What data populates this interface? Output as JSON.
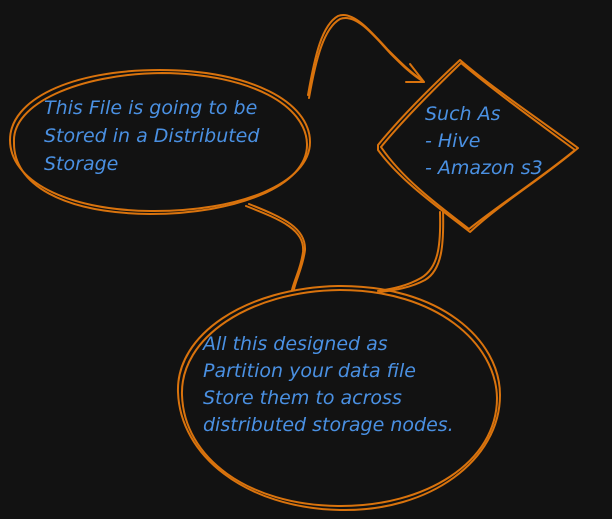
{
  "diagram": {
    "nodes": [
      {
        "id": "file-storage",
        "shape": "ellipse",
        "lines": [
          "This File is going to be",
          "Stored in a Distributed",
          "Storage"
        ]
      },
      {
        "id": "examples",
        "shape": "diamond",
        "lines": [
          "Such As",
          "- Hive",
          "- Amazon s3"
        ]
      },
      {
        "id": "partition",
        "shape": "ellipse",
        "lines": [
          "All this designed as",
          "Partition your data file",
          "Store them to across",
          "distributed storage nodes."
        ]
      }
    ],
    "edges": [
      {
        "from": "file-storage",
        "to": "examples",
        "arrow": true
      },
      {
        "from": "file-storage",
        "to": "partition",
        "arrow": false
      },
      {
        "from": "examples",
        "to": "partition",
        "arrow": false
      }
    ],
    "colors": {
      "background": "#121212",
      "stroke": "#d9730d",
      "text": "#4a90e2"
    }
  }
}
